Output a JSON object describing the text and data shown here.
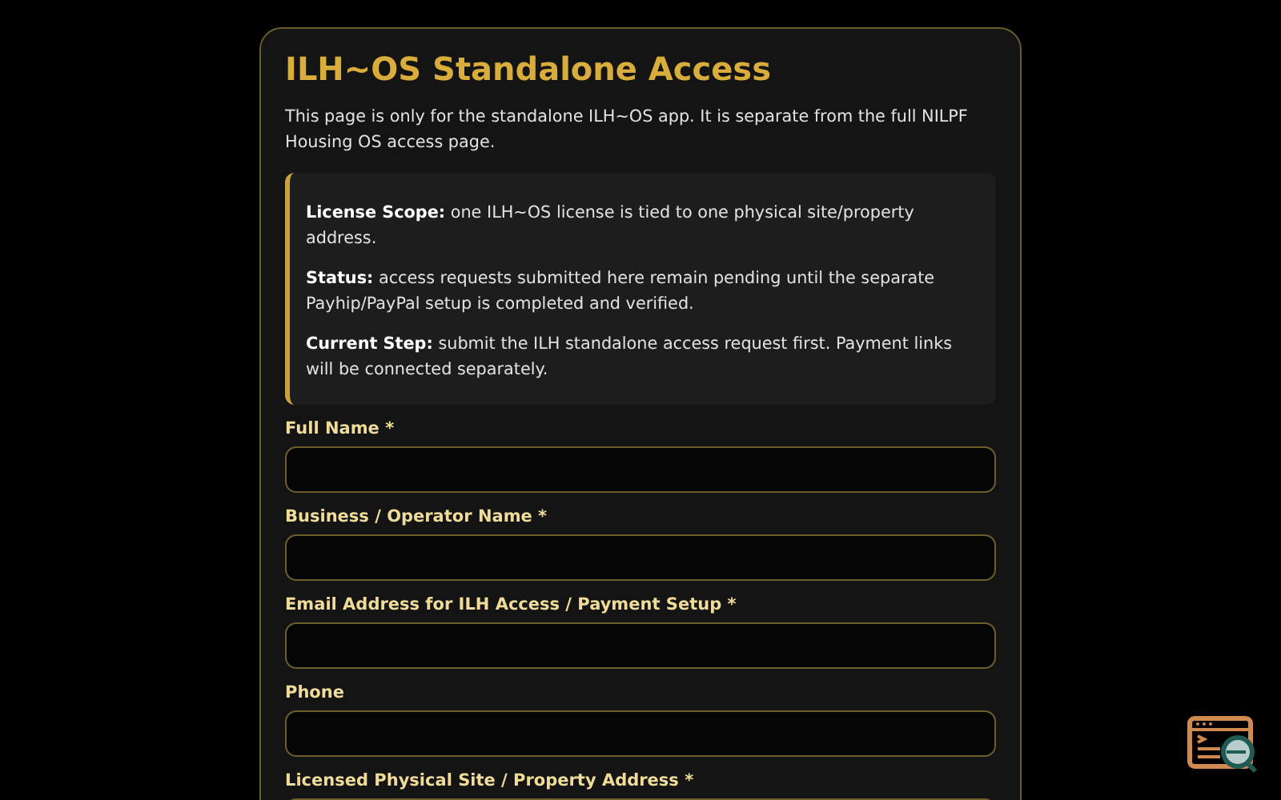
{
  "title": "ILH~OS Standalone Access",
  "intro": "This page is only for the standalone ILH~OS app. It is separate from the full NILPF Housing OS access page.",
  "notice": [
    "**License Scope:** one ILH~OS license is tied to one physical site/property address.",
    "**Status:** access requests submitted here remain pending until the separate Payhip/PayPal setup is completed and verified.",
    "**Current Step:** submit the ILH standalone access request first. Payment links will be connected separately."
  ],
  "fields": [
    {
      "label": "Full Name *"
    },
    {
      "label": "Business / Operator Name *"
    },
    {
      "label": "Email Address for ILH Access / Payment Setup *"
    },
    {
      "label": "Phone"
    },
    {
      "label": "Licensed Physical Site / Property Address *"
    }
  ]
}
